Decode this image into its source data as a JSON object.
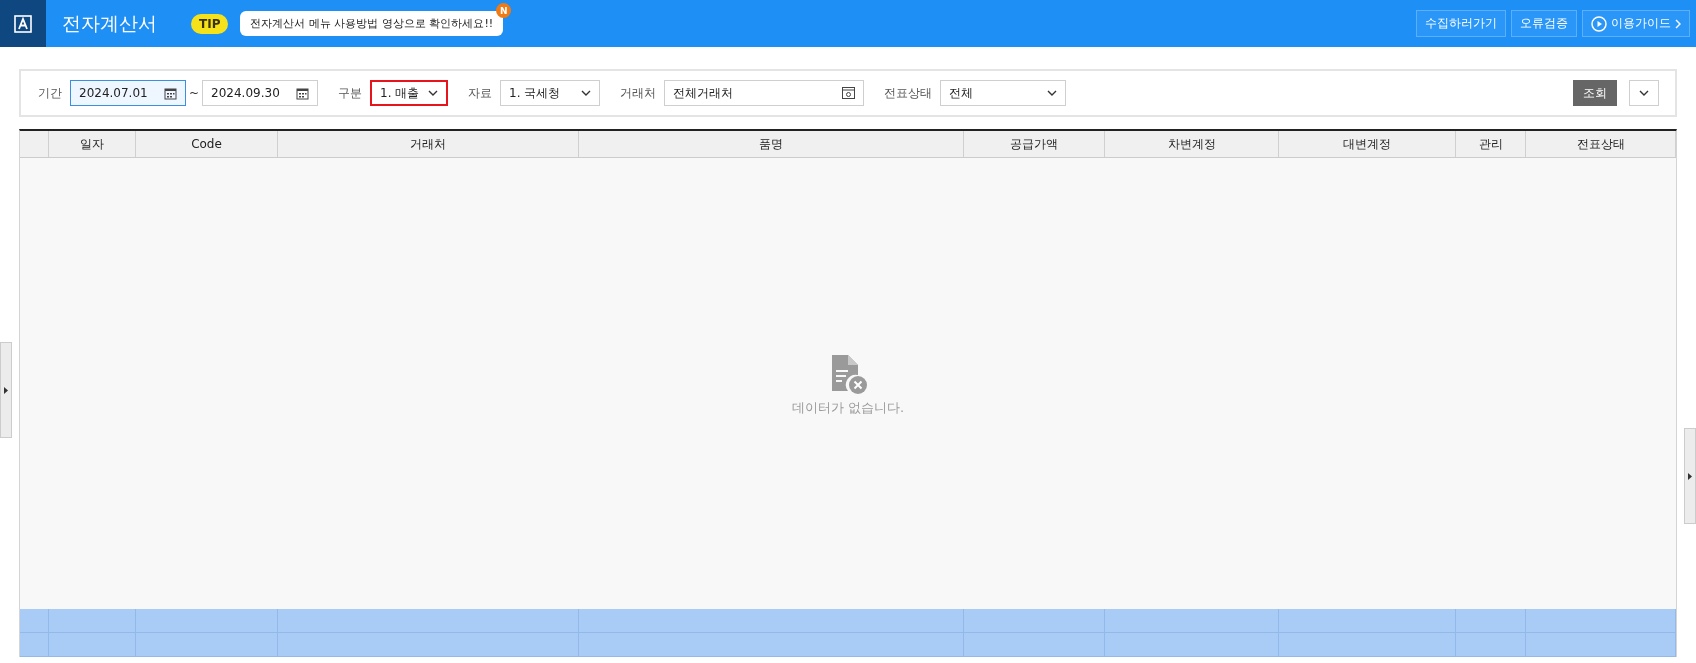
{
  "header": {
    "title": "전자계산서",
    "tip_badge": "TIP",
    "tip_text": "전자계산서 메뉴 사용방법 영상으로 확인하세요!!",
    "new_badge": "N",
    "buttons": [
      {
        "kind": "plain",
        "label": "수집하러가기"
      },
      {
        "kind": "plain",
        "label": "오류검증"
      },
      {
        "kind": "guide",
        "label": "이용가이드"
      }
    ]
  },
  "filters": [
    {
      "kind": "date_range",
      "label": "기간",
      "from": "2024.07.01",
      "separator": "~",
      "to": "2024.09.30",
      "focused": true
    },
    {
      "kind": "select",
      "label": "구분",
      "value": "1. 매출",
      "highlighted": true
    },
    {
      "kind": "select",
      "label": "자료",
      "value": "1. 국세청",
      "highlighted": false
    },
    {
      "kind": "lookup",
      "label": "거래처",
      "value": "전체거래처"
    },
    {
      "kind": "select",
      "label": "전표상태",
      "value": "전체",
      "highlighted": false
    }
  ],
  "search_button": "조회",
  "table": {
    "columns": [
      "일자",
      "Code",
      "거래처",
      "품명",
      "공급가액",
      "차변계정",
      "대변계정",
      "관리",
      "전표상태"
    ],
    "empty_message": "데이터가 없습니다."
  }
}
